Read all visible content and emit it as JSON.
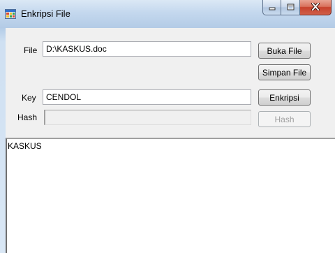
{
  "window": {
    "title": "Enkripsi File",
    "controls": {
      "minimize": "minimize",
      "maximize": "maximize",
      "close": "close"
    }
  },
  "form": {
    "file": {
      "label": "File",
      "value": "D:\\KASKUS.doc"
    },
    "key": {
      "label": "Key",
      "value": "CENDOL"
    },
    "hash": {
      "label": "Hash",
      "value": ""
    },
    "buttons": {
      "open": "Buka File",
      "save": "Simpan File",
      "encrypt": "Enkripsi",
      "hash": "Hash"
    },
    "content": {
      "text": "KASKUS"
    }
  },
  "colors": {
    "titlebar": "#c4d8ee",
    "client": "#f0f0f0",
    "close_button": "#c7412b"
  },
  "icons": {
    "app": "app-icon",
    "minimize": "minimize-icon",
    "maximize": "maximize-icon",
    "close": "close-icon"
  }
}
